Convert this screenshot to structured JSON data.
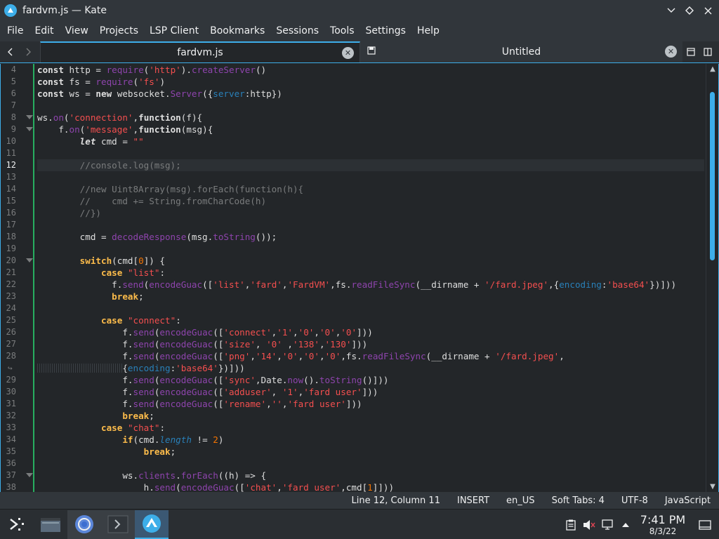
{
  "window": {
    "title": "fardvm.js — Kate"
  },
  "menu": [
    "File",
    "Edit",
    "View",
    "Projects",
    "LSP Client",
    "Bookmarks",
    "Sessions",
    "Tools",
    "Settings",
    "Help"
  ],
  "tabs": [
    {
      "label": "fardvm.js",
      "active": true
    },
    {
      "label": "Untitled",
      "active": false
    }
  ],
  "editor": {
    "current_line": 12,
    "lines": [
      {
        "n": "4",
        "text": "const http = require('http').createServer()"
      },
      {
        "n": "5",
        "text": "const fs = require('fs')"
      },
      {
        "n": "6",
        "text": "const ws = new websocket.Server({server:http})"
      },
      {
        "n": "7",
        "text": ""
      },
      {
        "n": "8",
        "text": "ws.on('connection',function(f){"
      },
      {
        "n": "9",
        "text": "    f.on('message',function(msg){"
      },
      {
        "n": "10",
        "text": "        let cmd = \"\""
      },
      {
        "n": "11",
        "text": ""
      },
      {
        "n": "12",
        "text": "        //console.log(msg);"
      },
      {
        "n": "13",
        "text": ""
      },
      {
        "n": "14",
        "text": "        //new Uint8Array(msg).forEach(function(h){"
      },
      {
        "n": "15",
        "text": "        //    cmd += String.fromCharCode(h)"
      },
      {
        "n": "16",
        "text": "        //})"
      },
      {
        "n": "17",
        "text": ""
      },
      {
        "n": "18",
        "text": "        cmd = decodeResponse(msg.toString());"
      },
      {
        "n": "19",
        "text": ""
      },
      {
        "n": "20",
        "text": "        switch(cmd[0]) {"
      },
      {
        "n": "21",
        "text": "            case \"list\":"
      },
      {
        "n": "22",
        "text": "              f.send(encodeGuac(['list','fard','FardVM',fs.readFileSync(__dirname + '/fard.jpeg',{encoding:'base64'})]))"
      },
      {
        "n": "23",
        "text": "              break;"
      },
      {
        "n": "24",
        "text": ""
      },
      {
        "n": "25",
        "text": "            case \"connect\":"
      },
      {
        "n": "26",
        "text": "                f.send(encodeGuac(['connect','1','0','0','0']))"
      },
      {
        "n": "27",
        "text": "                f.send(encodeGuac(['size', '0' ,'138','130']))"
      },
      {
        "n": "28",
        "text": "                f.send(encodeGuac(['png','14','0','0','0',fs.readFileSync(__dirname + '/fard.jpeg',"
      },
      {
        "n": "",
        "text": "                {encoding:'base64'})]))"
      },
      {
        "n": "29",
        "text": "                f.send(encodeGuac(['sync',Date.now().toString()]))"
      },
      {
        "n": "30",
        "text": "                f.send(encodeGuac(['adduser', '1','fard user']))"
      },
      {
        "n": "31",
        "text": "                f.send(encodeGuac(['rename','','fard user']))"
      },
      {
        "n": "32",
        "text": "                break;"
      },
      {
        "n": "33",
        "text": "            case \"chat\":"
      },
      {
        "n": "34",
        "text": "                if(cmd.length != 2)"
      },
      {
        "n": "35",
        "text": "                    break;"
      },
      {
        "n": "36",
        "text": ""
      },
      {
        "n": "37",
        "text": "                ws.clients.forEach((h) => {"
      },
      {
        "n": "38",
        "text": "                    h.send(encodeGuac(['chat','fard user',cmd[1]]))"
      }
    ]
  },
  "status": {
    "position": "Line 12, Column 11",
    "mode": "INSERT",
    "dictionary": "en_US",
    "indent": "Soft Tabs: 4",
    "encoding": "UTF-8",
    "language": "JavaScript"
  },
  "taskbar": {
    "time": "7:41 PM",
    "date": "8/3/22"
  },
  "colors": {
    "accent": "#3daee9",
    "modified": "#27ae60"
  }
}
